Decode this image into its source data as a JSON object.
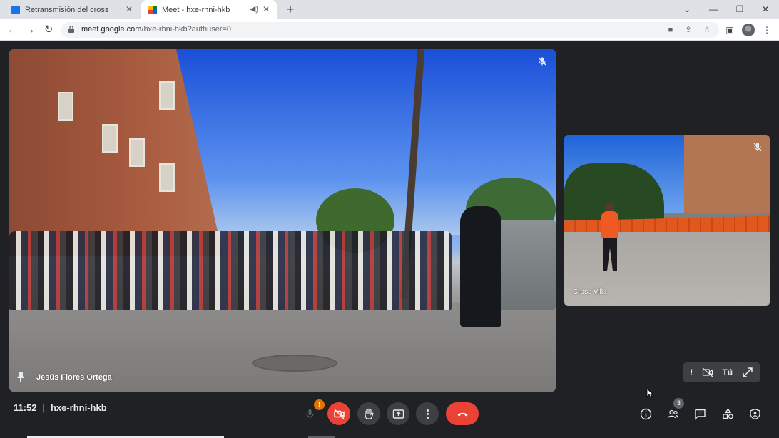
{
  "browser": {
    "tabs": [
      {
        "title": "Retransmisión del cross",
        "active": false
      },
      {
        "title": "Meet - hxe-rhni-hkb",
        "active": true
      }
    ],
    "url_host": "meet.google.com",
    "url_path": "/hxe-rhni-hkb?authuser=0"
  },
  "meet": {
    "main_participant": "Jesús Flores Ortega",
    "side_participant": "Cross Villa",
    "self_label": "Tú",
    "time": "11:52",
    "meeting_code": "hxe-rhni-hkb",
    "warning_badge": "!",
    "participant_count": "3",
    "self_warning": "!"
  },
  "colors": {
    "leave": "#ea4335",
    "warning": "#e37400",
    "background": "#202124",
    "control": "#3c4043"
  },
  "icons": [
    "mic-icon",
    "camera-off-icon",
    "raise-hand-icon",
    "present-icon",
    "more-icon",
    "hangup-icon",
    "info-icon",
    "people-icon",
    "chat-icon",
    "activities-icon",
    "host-controls-icon"
  ]
}
